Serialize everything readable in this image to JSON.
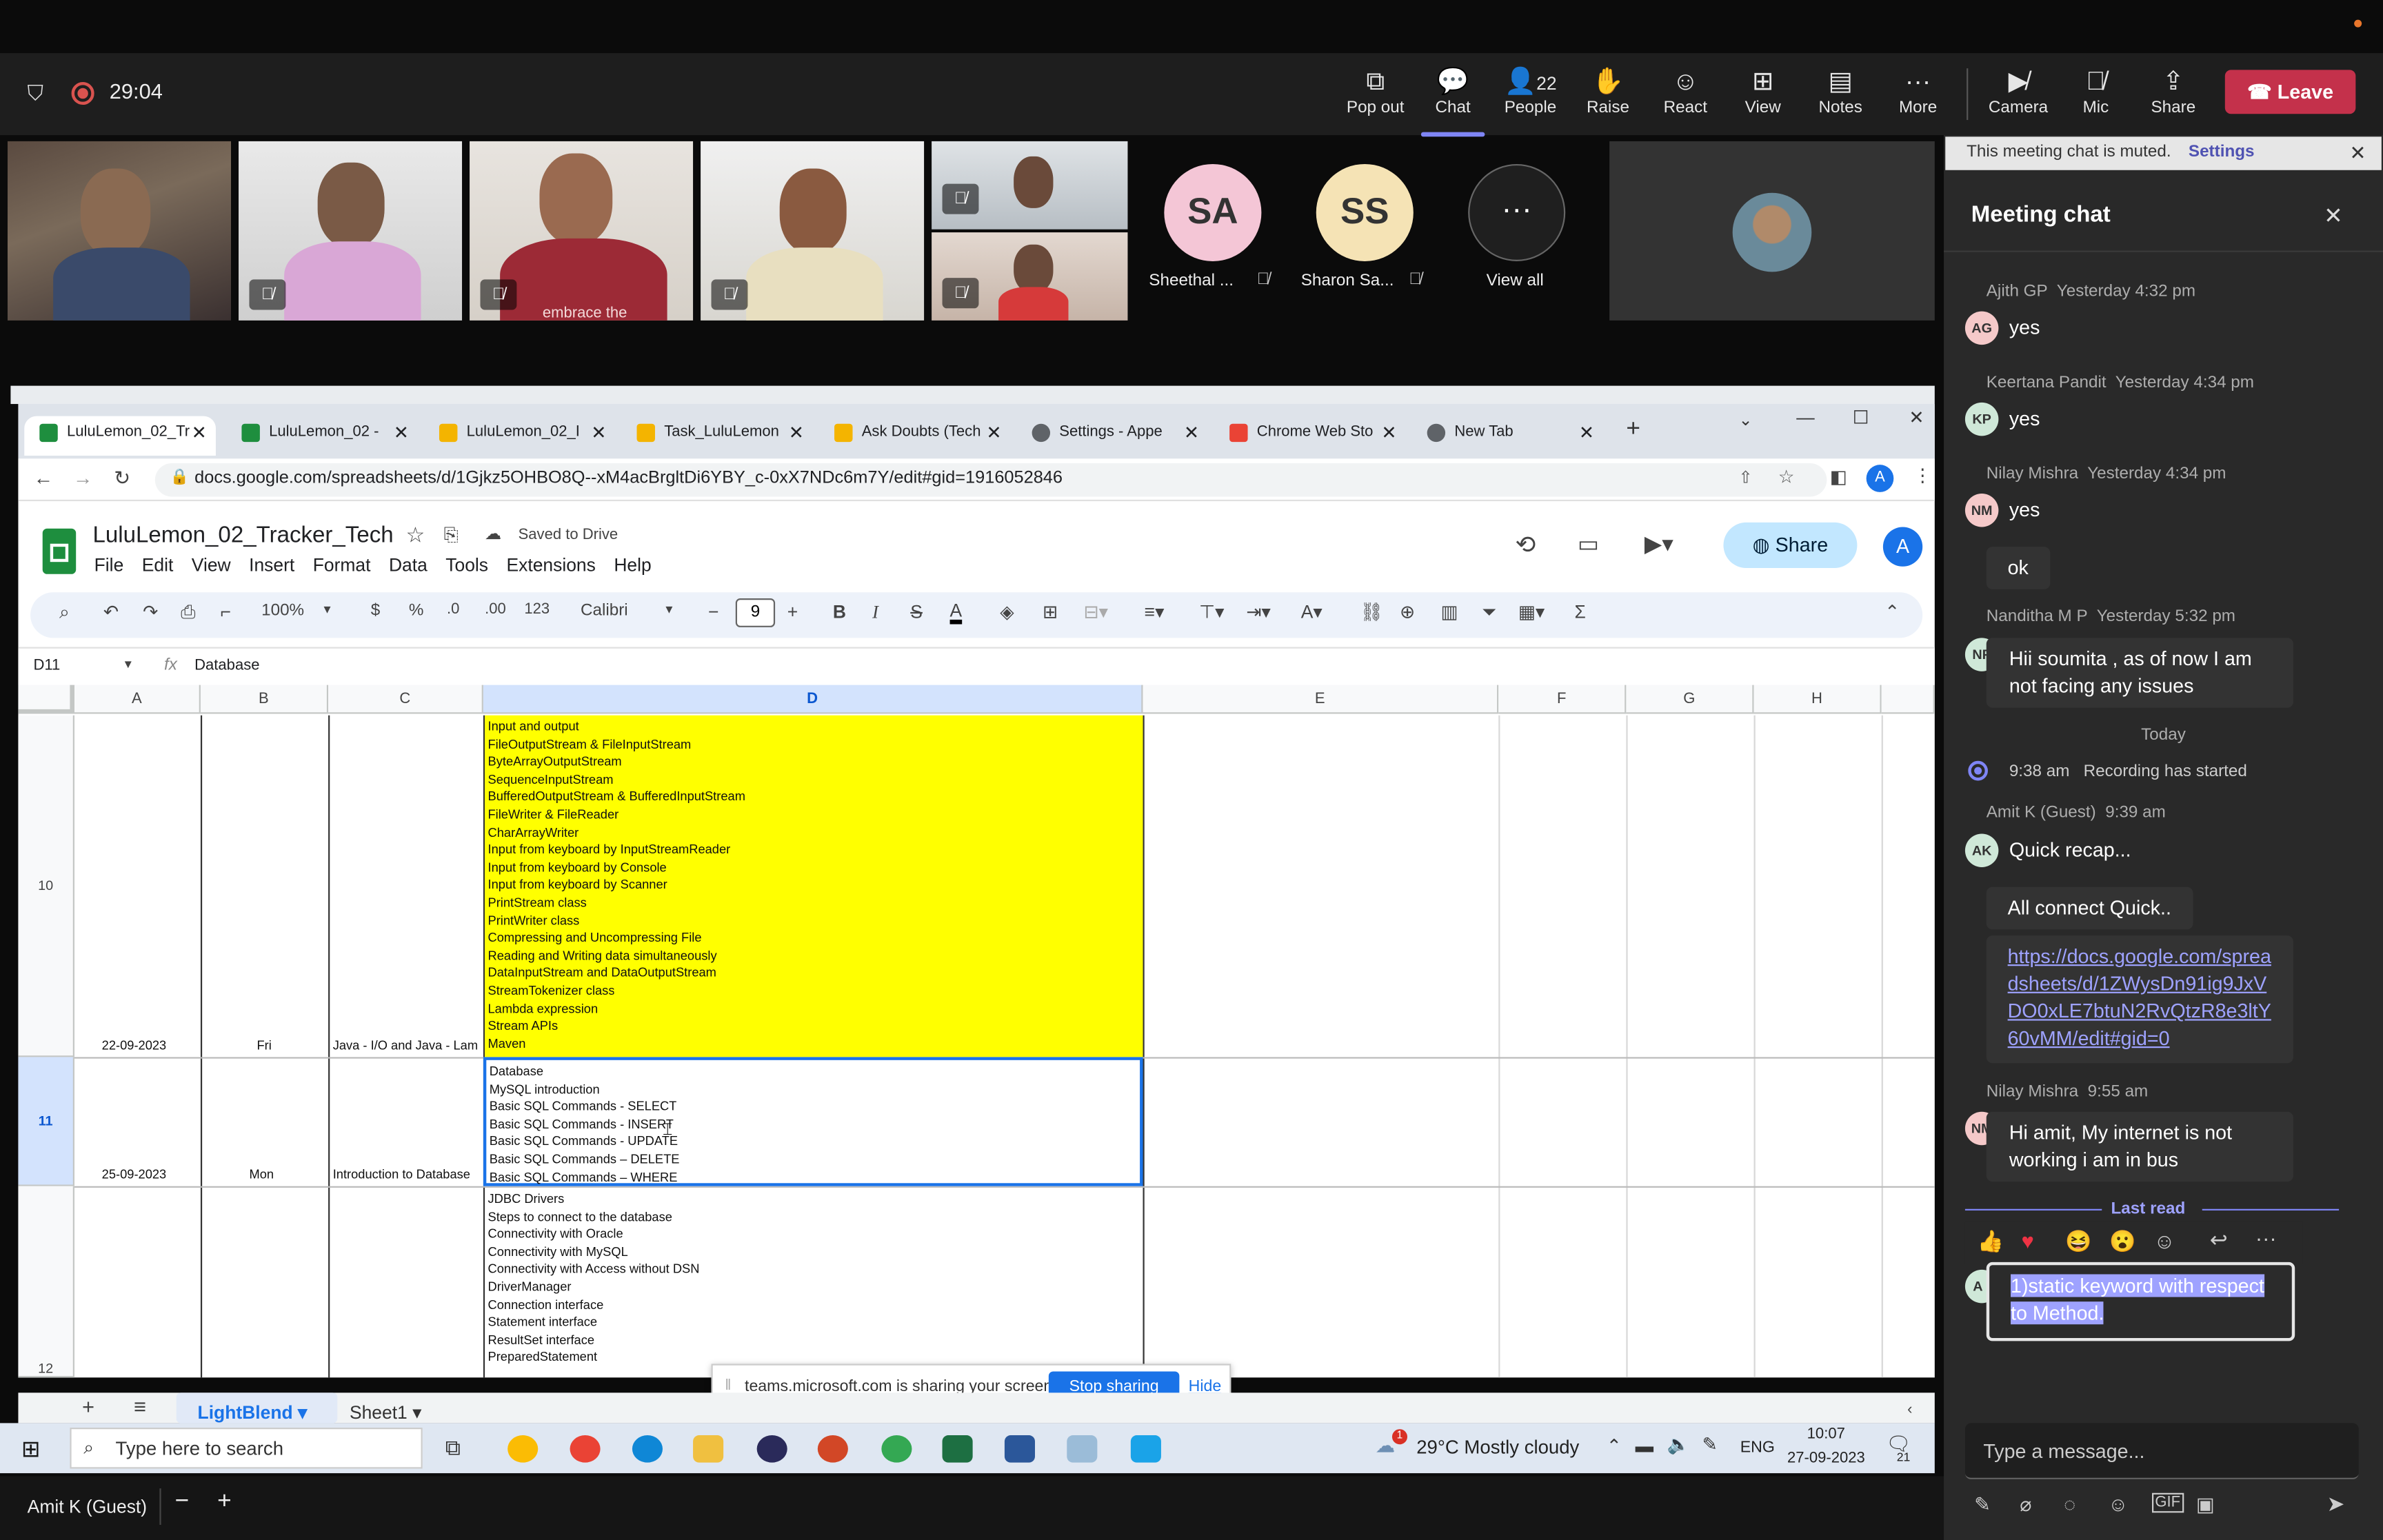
{
  "meeting": {
    "timer": "29:04",
    "toolbar": {
      "popout": "Pop out",
      "chat": "Chat",
      "people": "People",
      "people_count": "22",
      "raise": "Raise",
      "react": "React",
      "view": "View",
      "notes": "Notes",
      "more": "More",
      "camera": "Camera",
      "mic": "Mic",
      "share": "Share",
      "leave": "Leave"
    },
    "participants": [
      {
        "initials": "SA",
        "name": "Sheethal ...",
        "color": "#f4c6d6"
      },
      {
        "initials": "SS",
        "name": "Sharon Sa...",
        "color": "#f5e3b5"
      }
    ],
    "view_all": "View all",
    "embrace_text": "embrace the",
    "presenter_label": "Amit K (Guest)"
  },
  "chat": {
    "muted_notice": "This meeting chat is muted.",
    "muted_settings": "Settings",
    "title": "Meeting chat",
    "messages": [
      {
        "author": "Ajith GP",
        "time": "Yesterday 4:32 pm",
        "initials": "AG",
        "color": "#f5c9c9",
        "texts": [
          "yes"
        ]
      },
      {
        "author": "Keertana Pandit",
        "time": "Yesterday 4:34 pm",
        "initials": "KP",
        "color": "#cfe8d8",
        "texts": [
          "yes"
        ]
      },
      {
        "author": "Nilay Mishra",
        "time": "Yesterday 4:34 pm",
        "initials": "NM",
        "color": "#f5c9c9",
        "texts": [
          "yes",
          "ok"
        ]
      },
      {
        "author": "Nanditha M P",
        "time": "Yesterday 5:32 pm",
        "initials": "NP",
        "color": "#cfe8d8",
        "texts": [
          "Hii soumita , as of now I am not facing any issues"
        ]
      }
    ],
    "date_divider": "Today",
    "recording": {
      "time": "9:38 am",
      "text": "Recording has started"
    },
    "amit": {
      "author": "Amit K (Guest)",
      "time": "9:39 am",
      "initials": "AK",
      "color": "#cfe8d8",
      "texts": [
        "Quick recap...",
        "All connect Quick.."
      ],
      "link": "https://docs.google.com/spreadsheets/d/1ZWysDn91ig9JxVDO0xLE7btuN2RvQtzR8e3ltY60vMM/edit#gid=0"
    },
    "nilay2": {
      "author": "Nilay Mishra",
      "time": "9:55 am",
      "initials": "NM",
      "color": "#f5c9c9",
      "text": "Hi amit, My internet is not working i am in bus"
    },
    "last_read": "Last read",
    "composing": {
      "initials": "A (",
      "text": "1)static keyword with respect to Method."
    },
    "input_placeholder": "Type a message..."
  },
  "browser": {
    "tabs": [
      {
        "label": "LuluLemon_02_Tr",
        "color": "#1e8e3e"
      },
      {
        "label": "LuluLemon_02 -",
        "color": "#1e8e3e"
      },
      {
        "label": "LuluLemon_02_I",
        "color": "#f4b400"
      },
      {
        "label": "Task_LuluLemon",
        "color": "#f4b400"
      },
      {
        "label": "Ask Doubts (Tech",
        "color": "#f4b400"
      },
      {
        "label": "Settings - Appe",
        "color": "#5f6368"
      },
      {
        "label": "Chrome Web Sto",
        "color": "#ea4335"
      },
      {
        "label": "New Tab",
        "color": "#5f6368"
      }
    ],
    "url": "docs.google.com/spreadsheets/d/1Gjkz5OHBO8Q--xM4acBrgltDi6YBY_c-0xX7NDc6m7Y/edit#gid=1916052846",
    "profile": "A"
  },
  "sheets": {
    "title": "LuluLemon_02_Tracker_Tech",
    "saved": "Saved to Drive",
    "share": "Share",
    "menu": [
      "File",
      "Edit",
      "View",
      "Insert",
      "Format",
      "Data",
      "Tools",
      "Extensions",
      "Help"
    ],
    "zoom": "100%",
    "currency": "$",
    "percent": "%",
    "dec_dec": ".0",
    "dec_inc": ".00",
    "num_fmt": "123",
    "font": "Calibri",
    "font_size": "9",
    "name_box": "D11",
    "formula": "Database",
    "columns": [
      "A",
      "B",
      "C",
      "D",
      "E",
      "F",
      "G",
      "H"
    ],
    "row10": {
      "num": "10",
      "date": "22-09-2023",
      "day": "Fri",
      "topic": "Java - I/O and Java - Lam",
      "lines": [
        "Input and output",
        "FileOutputStream & FileInputStream",
        "ByteArrayOutputStream",
        "SequenceInputStream",
        "BufferedOutputStream & BufferedInputStream",
        "FileWriter & FileReader",
        "CharArrayWriter",
        "Input from keyboard by InputStreamReader",
        "Input from keyboard by Console",
        "Input from keyboard by Scanner",
        "PrintStream class",
        "PrintWriter class",
        "Compressing and Uncompressing File",
        "Reading and Writing data simultaneously",
        "DataInputStream and DataOutputStream",
        "StreamTokenizer class",
        "Lambda expression",
        "Stream APIs",
        "Maven"
      ]
    },
    "row11": {
      "num": "11",
      "date": "25-09-2023",
      "day": "Mon",
      "topic": "Introduction to Database",
      "lines": [
        "Database",
        "MySQL introduction",
        "Basic SQL Commands - SELECT",
        "Basic SQL Commands - INSERT",
        "Basic SQL Commands - UPDATE",
        "Basic SQL Commands – DELETE",
        "Basic SQL Commands – WHERE"
      ]
    },
    "row12": {
      "num": "12",
      "lines": [
        "JDBC Drivers",
        "Steps to connect to the database",
        "Connectivity with Oracle",
        "Connectivity with MySQL",
        "Connectivity with Access without DSN",
        "DriverManager",
        "Connection interface",
        "Statement interface",
        "ResultSet interface",
        "PreparedStatement"
      ]
    },
    "sheet_tabs": [
      "LightBlend",
      "Sheet1"
    ],
    "share_banner": {
      "text": "teams.microsoft.com is sharing your screen.",
      "stop": "Stop sharing",
      "hide": "Hide"
    }
  },
  "taskbar": {
    "search": "Type here to search",
    "weather": "29°C  Mostly cloudy",
    "lang": "ENG",
    "time": "10:07",
    "date": "27-09-2023",
    "notif": "21",
    "weather_badge": "1"
  }
}
